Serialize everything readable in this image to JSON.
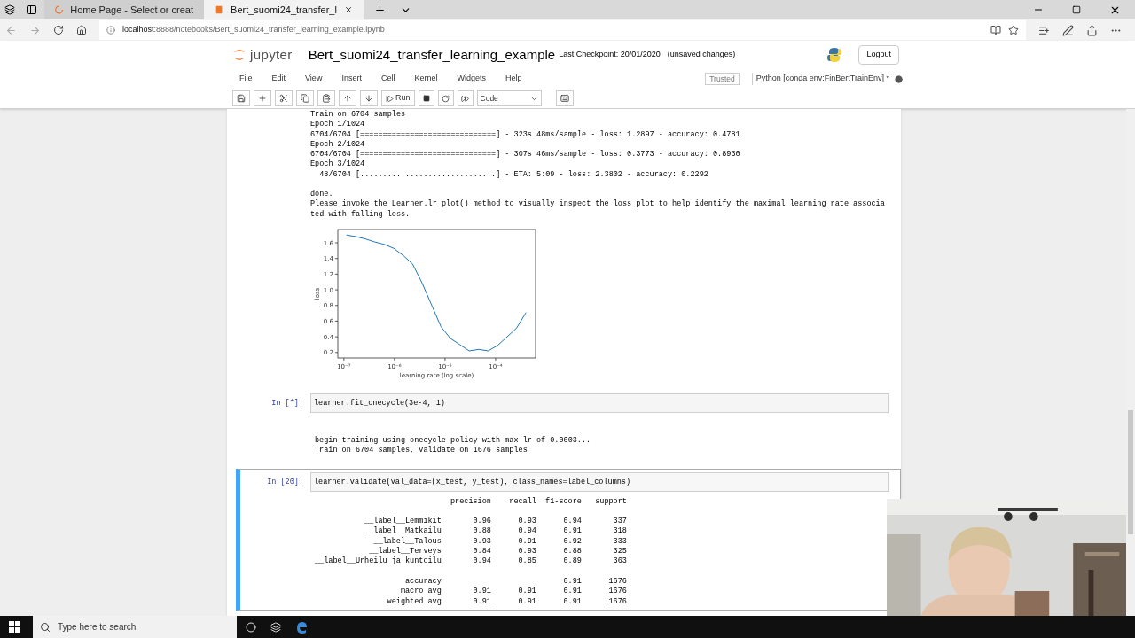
{
  "browser": {
    "tabs": [
      {
        "title": "Home Page - Select or creat",
        "kind": "loading",
        "selected": false
      },
      {
        "title": "Bert_suomi24_transfer_l",
        "kind": "notebook",
        "selected": true
      }
    ],
    "address_host": "localhost",
    "address_path": ":8888/notebooks/Bert_suomi24_transfer_learning_example.ipynb"
  },
  "jupyter": {
    "logo_text": "jupyter",
    "notebook_name": "Bert_suomi24_transfer_learning_example",
    "checkpoint": "Last Checkpoint: 20/01/2020",
    "save_status": "(unsaved changes)",
    "logout": "Logout"
  },
  "menu": {
    "items": [
      "File",
      "Edit",
      "View",
      "Insert",
      "Cell",
      "Kernel",
      "Widgets",
      "Help"
    ],
    "trusted": "Trusted",
    "kernel": "Python [conda env:FinBertTrainEnv] *",
    "kernel_busy": true
  },
  "toolbar": {
    "run": "Run",
    "cell_type": "Code"
  },
  "cells": [
    {
      "kind": "output",
      "lines": [
        "Train on 6704 samples",
        "Epoch 1/1024",
        "6704/6704 [==============================] - 323s 48ms/sample - loss: 1.2897 - accuracy: 0.4781",
        "Epoch 2/1024",
        "6704/6704 [==============================] - 307s 46ms/sample - loss: 0.3773 - accuracy: 0.8930",
        "Epoch 3/1024",
        "  48/6704 [..............................] - ETA: 5:09 - loss: 2.3802 - accuracy: 0.2292"
      ],
      "lines_after": [
        "done.",
        "Please invoke the Learner.lr_plot() method to visually inspect the loss plot to help identify the maximal learning rate associa",
        "ted with falling loss."
      ],
      "chart_data": {
        "type": "line",
        "xlabel": "learning rate (log scale)",
        "ylabel": "loss",
        "series": [
          {
            "color": "#1f77b4",
            "values": [
              1.7,
              1.68,
              1.65,
              1.61,
              1.58,
              1.53,
              1.44,
              1.33,
              1.09,
              0.81,
              0.53,
              0.38,
              0.3,
              0.22,
              0.24,
              0.22,
              0.29,
              0.4,
              0.51,
              0.71
            ]
          }
        ],
        "ylim": [
          0.13,
          1.77
        ],
        "yticks": [
          {
            "value": 0.2,
            "label": "0.2"
          },
          {
            "value": 0.4,
            "label": "0.4"
          },
          {
            "value": 0.6,
            "label": "0.6"
          },
          {
            "value": 0.8,
            "label": "0.8"
          },
          {
            "value": 1.0,
            "label": "1.0"
          },
          {
            "value": 1.2,
            "label": "1.2"
          },
          {
            "value": 1.4,
            "label": "1.4"
          },
          {
            "value": 1.6,
            "label": "1.6"
          }
        ]
      },
      "x_axis_tick_labels": [
        "10⁻⁷",
        "10⁻⁶",
        "10⁻⁵",
        "10⁻⁴"
      ]
    },
    {
      "kind": "code",
      "selected": false,
      "prompt": "In [*]:",
      "code": "learner.fit_onecycle(3e-4, 1)",
      "lines": [
        "begin training using onecycle policy with max lr of 0.0003...",
        "Train on 6704 samples, validate on 1676 samples"
      ]
    },
    {
      "kind": "code",
      "selected": true,
      "prompt": "In [20]:",
      "code": "learner.validate(val_data=(x_test, y_test), class_names=label_columns)",
      "report": {
        "columns": [
          "precision",
          "recall",
          "f1-score",
          "support"
        ],
        "rows": [
          {
            "label": "__label__Lemmikit",
            "precision": "0.96",
            "recall": "0.93",
            "f1_score": "0.94",
            "support": "337"
          },
          {
            "label": "__label__Matkailu",
            "precision": "0.88",
            "recall": "0.94",
            "f1_score": "0.91",
            "support": "318"
          },
          {
            "label": "__label__Talous",
            "precision": "0.93",
            "recall": "0.91",
            "f1_score": "0.92",
            "support": "333"
          },
          {
            "label": "__label__Terveys",
            "precision": "0.84",
            "recall": "0.93",
            "f1_score": "0.88",
            "support": "325"
          },
          {
            "label": "__label__Urheilu ja kuntoilu",
            "precision": "0.94",
            "recall": "0.85",
            "f1_score": "0.89",
            "support": "363"
          }
        ],
        "summary": [
          {
            "label": "accuracy",
            "f1_score": "0.91",
            "support": "1676"
          },
          {
            "label": "macro avg",
            "precision": "0.91",
            "recall": "0.91",
            "f1_score": "0.91",
            "support": "1676"
          },
          {
            "label": "weighted avg",
            "precision": "0.91",
            "recall": "0.91",
            "f1_score": "0.91",
            "support": "1676"
          }
        ]
      }
    }
  ],
  "taskbar": {
    "search_placeholder": "Type here to search"
  }
}
